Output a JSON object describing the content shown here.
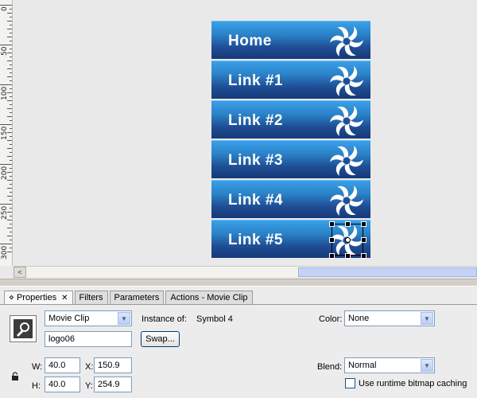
{
  "ruler": {
    "labels": [
      "0",
      "50",
      "100",
      "150",
      "200",
      "250",
      "300"
    ]
  },
  "menu": {
    "items": [
      {
        "label": "Home"
      },
      {
        "label": "Link #1"
      },
      {
        "label": "Link #2"
      },
      {
        "label": "Link #3"
      },
      {
        "label": "Link #4"
      },
      {
        "label": "Link #5"
      }
    ],
    "icon": "swirl-logo-icon",
    "colors": {
      "top": "#3aa0e8",
      "bottom": "#163a78"
    }
  },
  "scrollbar": {
    "left_arrow": "<"
  },
  "panel": {
    "tabs": [
      {
        "label": "Properties",
        "close": "✕"
      },
      {
        "label": "Filters"
      },
      {
        "label": "Parameters"
      },
      {
        "label": "Actions - Movie Clip"
      }
    ],
    "symbol_type": "Movie Clip",
    "instance_of_label": "Instance of:",
    "instance_of_value": "Symbol 4",
    "instance_name": "logo06",
    "swap_button": "Swap...",
    "color_label": "Color:",
    "color_value": "None",
    "blend_label": "Blend:",
    "blend_value": "Normal",
    "w_label": "W:",
    "w_value": "40.0",
    "h_label": "H:",
    "h_value": "40.0",
    "x_label": "X:",
    "x_value": "150.9",
    "y_label": "Y:",
    "y_value": "254.9",
    "cache_label": "Use runtime bitmap caching"
  }
}
